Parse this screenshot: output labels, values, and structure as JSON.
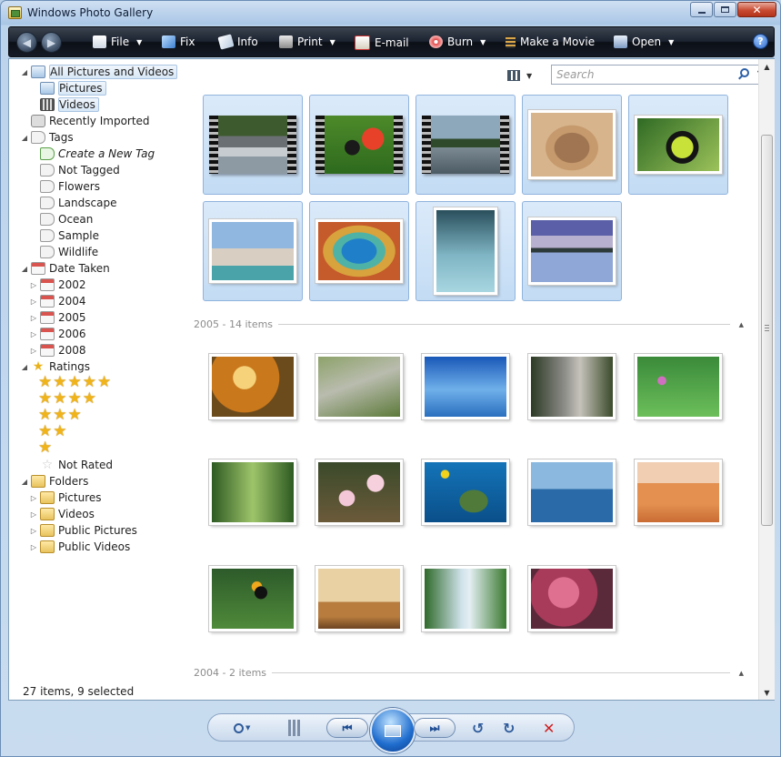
{
  "window": {
    "title": "Windows Photo Gallery"
  },
  "toolbar": {
    "file": "File",
    "fix": "Fix",
    "info": "Info",
    "print": "Print",
    "email": "E-mail",
    "burn": "Burn",
    "make_movie": "Make a Movie",
    "open": "Open",
    "help": "?"
  },
  "nav": {
    "all": "All Pictures and Videos",
    "pictures": "Pictures",
    "videos": "Videos",
    "recently": "Recently Imported",
    "tags": "Tags",
    "create_tag": "Create a New Tag",
    "not_tagged": "Not Tagged",
    "flowers": "Flowers",
    "landscape": "Landscape",
    "ocean": "Ocean",
    "sample": "Sample",
    "wildlife": "Wildlife",
    "date_taken": "Date Taken",
    "y2002": "2002",
    "y2004": "2004",
    "y2005": "2005",
    "y2006": "2006",
    "y2008": "2008",
    "ratings": "Ratings",
    "stars5": "★★★★★",
    "stars4": "★★★★",
    "stars3": "★★★",
    "stars2": "★★",
    "stars1": "★",
    "not_rated": "Not Rated",
    "folders": "Folders",
    "f_pictures": "Pictures",
    "f_videos": "Videos",
    "f_public_pictures": "Public Pictures",
    "f_public_videos": "Public Videos"
  },
  "search": {
    "placeholder": "Search"
  },
  "groups": {
    "g2005": "2005 - 14 items",
    "g2004": "2004 - 2 items"
  },
  "status": "27 items, 9 selected",
  "colors": {
    "accent": "#c3dcf4",
    "toolbar": "#1c2330",
    "star": "#f0b41a"
  }
}
